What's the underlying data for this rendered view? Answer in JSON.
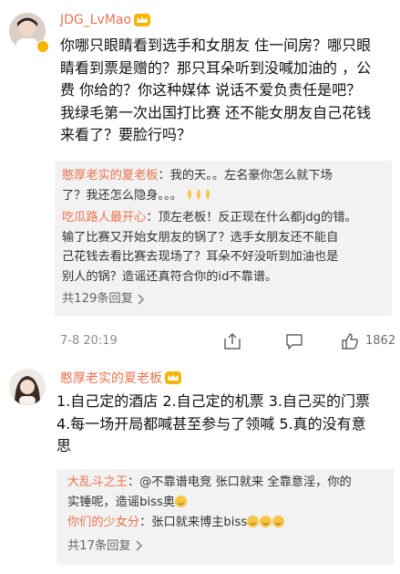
{
  "posts": [
    {
      "username": "JDG_LvMao",
      "content_lines": [
        "你哪只眼睛看到选手和女朋友 住一间房？哪只眼",
        "睛看到票是赠的？那只耳朵听到没喊加油的 ，公",
        "费 你给的？你这种媒体 说话不爱负责任是吧？",
        "我绿毛第一次出国打比赛 还不能女朋友自己花钱",
        "来看了？要脸行吗？"
      ],
      "replies": [
        {
          "name": "憨厚老实的夏老板",
          "lines": [
            "：我的天。。左名豪你怎么就下场",
            "了？我还怎么隐身。。。"
          ]
        },
        {
          "name": "吃瓜路人最开心",
          "lines": [
            "：顶左老板！反正现在什么都jdg的错。",
            "输了比赛又开始女朋友的锅了？选手女朋友还不能自",
            "己花钱去看比赛去现场了？耳朵不好没听到加油也是",
            "别人的锅？造谣还真符合你的id不靠谱。"
          ]
        }
      ],
      "more_replies": "共129条回复",
      "time": "7-8 20:19",
      "likes": "1862"
    },
    {
      "username": "憨厚老实的夏老板",
      "content_lines": [
        "1.自己定的酒店 2.自己定的机票 3.自己买的门票",
        "4.每一场开局都喊甚至参与了领喊 5.真的没有意",
        "思"
      ],
      "replies": [
        {
          "name": "大乱斗之王",
          "lines": [
            "：@不靠谱电竞 张口就来 全靠意淫，你的",
            "实锤呢，造谣biss奥"
          ]
        },
        {
          "name": "你们的少女分",
          "lines": [
            "：张口就来博主biss"
          ]
        }
      ],
      "more_replies": "共17条回复"
    }
  ],
  "icons": {
    "crown": "vip-crown-icon",
    "share": "share-icon",
    "comment": "comment-icon",
    "like": "thumbs-up-icon"
  },
  "colors": {
    "username": "#eb7350",
    "reply_bg": "#f2f2f2"
  }
}
